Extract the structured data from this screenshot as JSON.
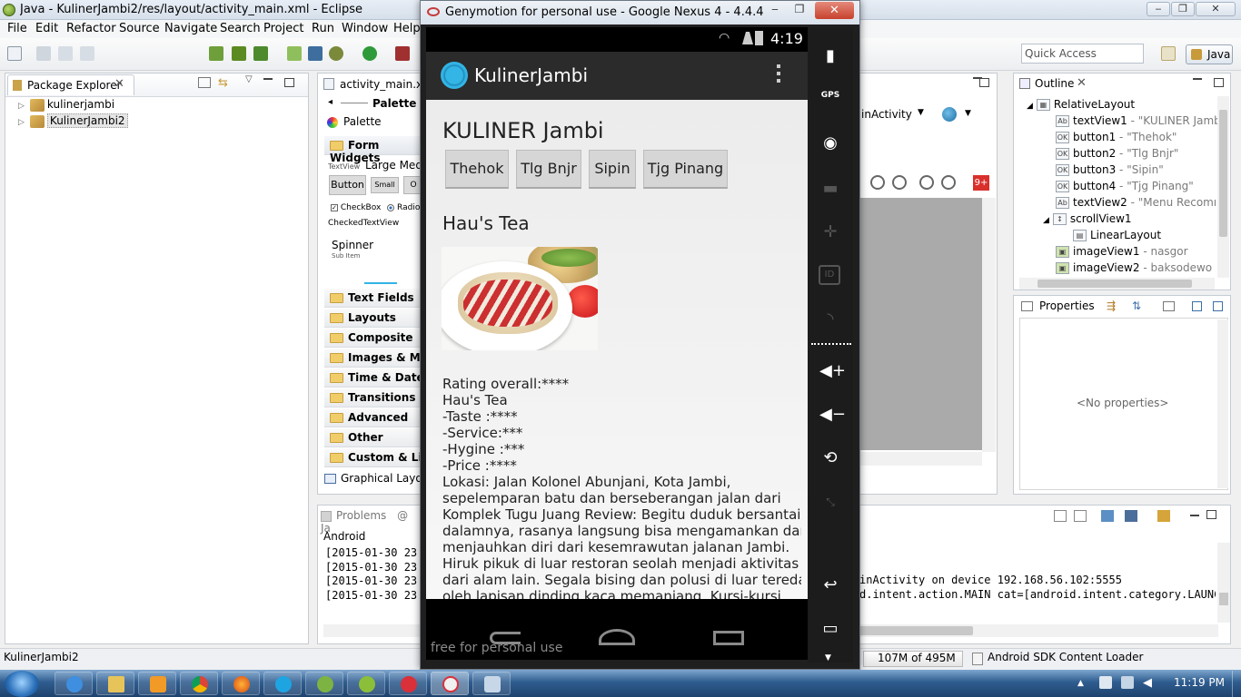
{
  "eclipse": {
    "title": "Java - KulinerJambi2/res/layout/activity_main.xml - Eclipse",
    "menu": [
      "File",
      "Edit",
      "Refactor",
      "Source",
      "Navigate",
      "Search",
      "Project",
      "Run",
      "Window",
      "Help"
    ],
    "quick_access_placeholder": "Quick Access",
    "perspective": "Java",
    "status_left": "KulinerJambi2",
    "heap": "107M of 495M",
    "sdk_loader": "Android SDK Content Loader"
  },
  "package_explorer": {
    "tab": "Package Explorer",
    "items": [
      "kulinerjambi",
      "KulinerJambi2"
    ]
  },
  "editor": {
    "tab": "activity_main.xml",
    "palette_header": "Palette",
    "palette_title": "Palette",
    "form_widgets": "Form Widgets",
    "textview_sizes": "TextView",
    "textview_large": "Large Mediu",
    "btn_button": "Button",
    "btn_small": "Small",
    "btn_off": "O",
    "checkbox": "CheckBox",
    "radio": "Radio",
    "checked_textview": "CheckedTextView",
    "spinner": "Spinner",
    "spinner_sub": "Sub Item",
    "categories": [
      "Text Fields",
      "Layouts",
      "Composite",
      "Images & Med",
      "Time & Date",
      "Transitions",
      "Advanced",
      "Other",
      "Custom & Libr"
    ],
    "graphical_tab": "Graphical Layou",
    "device_combo": "inActivity",
    "error_badge": "9+"
  },
  "console": {
    "tab_problems": "Problems",
    "tab_js": "@ Ja",
    "label": "Android",
    "lines_left": [
      "[2015-01-30 23:",
      "[2015-01-30 23:",
      "[2015-01-30 23:",
      "[2015-01-30 23:"
    ],
    "line_right_1": "inActivity on device 192.168.56.102:5555",
    "line_right_2": "d.intent.action.MAIN cat=[android.intent.category.LAUNCH"
  },
  "outline": {
    "tab": "Outline",
    "root": "RelativeLayout",
    "items": [
      {
        "name": "textView1",
        "detail": "- \"KULINER Jambi\""
      },
      {
        "name": "button1",
        "detail": "- \"Thehok\""
      },
      {
        "name": "button2",
        "detail": "- \"Tlg Bnjr\""
      },
      {
        "name": "button3",
        "detail": "- \"Sipin\""
      },
      {
        "name": "button4",
        "detail": "- \"Tjg Pinang\""
      },
      {
        "name": "textView2",
        "detail": "- \"Menu Recomme"
      },
      {
        "name": "scrollView1",
        "detail": ""
      },
      {
        "name": "LinearLayout",
        "detail": ""
      },
      {
        "name": "imageView1",
        "detail": "- nasgor"
      },
      {
        "name": "imageView2",
        "detail": "- baksodewo"
      }
    ]
  },
  "properties": {
    "tab": "Properties",
    "empty": "<No properties>"
  },
  "emulator": {
    "title": "Genymotion for personal use - Google Nexus 4 - 4.4.4 - API 19 ...",
    "time": "4:19",
    "watermark": "free for personal use",
    "side_labels": {
      "gps": "GPS",
      "id": "ID"
    }
  },
  "app": {
    "name": "KulinerJambi",
    "heading": "KULINER Jambi",
    "buttons": [
      "Thehok",
      "Tlg Bnjr",
      "Sipin",
      "Tjg Pinang"
    ],
    "place_title": "Hau's Tea",
    "details": [
      "Rating overall:****",
      " Hau's Tea",
      " -Taste  :****",
      " -Service:***",
      " -Hygine :***",
      " -Price  :****",
      " Lokasi:  Jalan Kolonel Abunjani, Kota Jambi,",
      "sepelemparan batu dan berseberangan jalan dari",
      "Komplek Tugu Juang Review: Begitu duduk bersantai di",
      "dalamnya, rasanya langsung bisa mengamankan dan",
      "menjauhkan diri dari kesemrawutan jalanan Jambi.",
      "Hiruk pikuk di luar restoran seolah menjadi aktivitas",
      "dari alam lain.   Segala bising dan polusi di luar teredam",
      "oleh lapisan dinding kaca memanjang. Kursi-kursi"
    ]
  },
  "taskbar": {
    "clock": "11:19 PM"
  },
  "colors": {
    "accent_blue": "#33b5e5",
    "actionbar": "#2b2b2b",
    "taskbar": "#2f5d8f"
  }
}
